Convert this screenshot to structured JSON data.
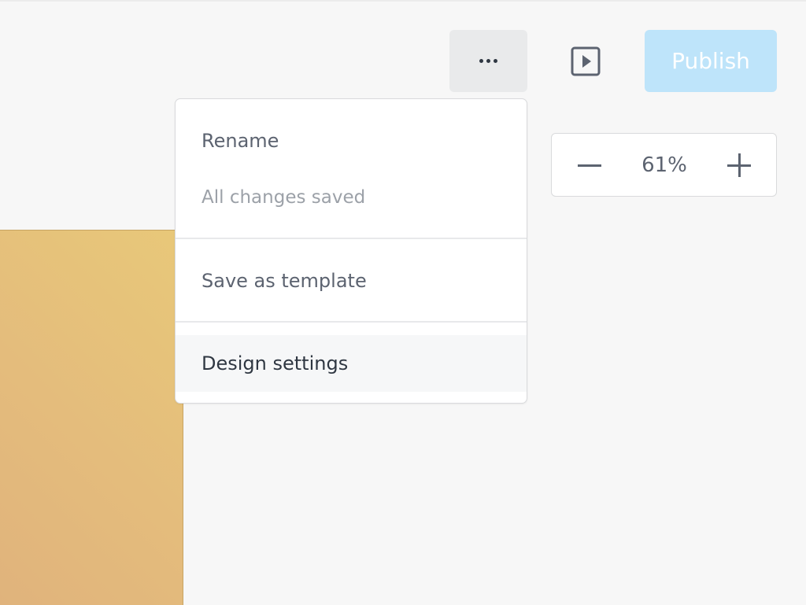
{
  "toolbar": {
    "more_icon": "more-horizontal-icon",
    "play_icon": "play-preview-icon",
    "publish_label": "Publish",
    "publish_color": "#bee4fa"
  },
  "menu": {
    "rename_label": "Rename",
    "status_text": "All changes saved",
    "save_template_label": "Save as template",
    "design_settings_label": "Design settings"
  },
  "zoom": {
    "level": "61%",
    "minus_icon": "minus-icon",
    "plus_icon": "plus-icon"
  },
  "canvas": {
    "preview_color": "#e4bc7c"
  }
}
